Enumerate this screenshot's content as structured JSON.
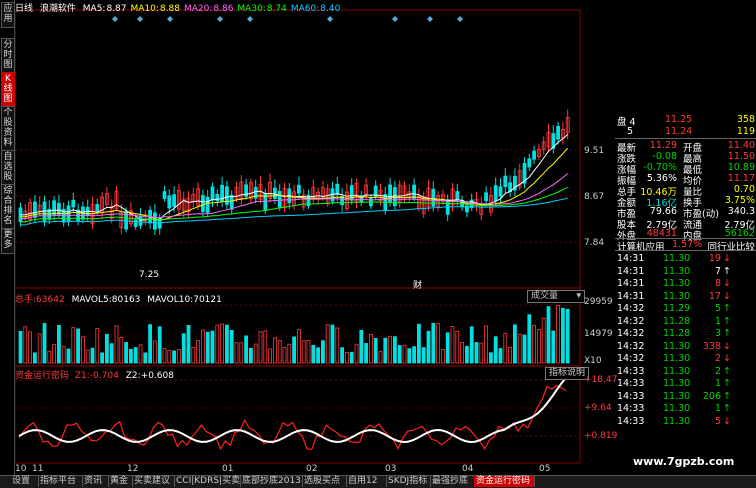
{
  "left_tabs": [
    "应用",
    "分时图",
    "K线图",
    "个股资料",
    "自选股",
    "综合排名",
    "更多"
  ],
  "header": {
    "period": "日线",
    "stock": "浪潮软件",
    "ma": [
      {
        "label": "MA5:",
        "value": "8.87",
        "color": "#ffffff"
      },
      {
        "label": "MA10:",
        "value": "8.88",
        "color": "#ffff00"
      },
      {
        "label": "MA20:",
        "value": "8.86",
        "color": "#ff66ff"
      },
      {
        "label": "MA30:",
        "value": "8.74",
        "color": "#00ff00"
      },
      {
        "label": "MA60:",
        "value": "8.40",
        "color": "#00ccff"
      }
    ]
  },
  "price_axis": [
    "9.51",
    "8.67",
    "7.84"
  ],
  "low_marker": "7.25",
  "cai_marker": "财",
  "volume_header": {
    "label": "总手:",
    "value": "63642",
    "ma5_label": "MAVOL5:",
    "ma5": "80163",
    "ma10_label": "MAVOL10:",
    "ma10": "70121",
    "btn": "成交量"
  },
  "volume_axis": [
    "29959",
    "14979",
    "X10"
  ],
  "indicator_header": {
    "name": "资金运行密码",
    "z1_label": "Z1:",
    "z1": "-0.704",
    "z2_label": "Z2:",
    "z2": "+0.608",
    "btn": "指标说明"
  },
  "indicator_axis": [
    "+18.47",
    "+9.64",
    "+0.819"
  ],
  "date_axis": [
    "10",
    "11",
    "12",
    "01",
    "02",
    "03",
    "04",
    "05"
  ],
  "quote": {
    "bid_rows": [
      {
        "label": "盘 4",
        "price": "11.25",
        "vol": "358"
      },
      {
        "label": "5",
        "price": "11.24",
        "vol": "119"
      }
    ],
    "stats": [
      {
        "l1": "最新",
        "v1": "11.29",
        "c1": "red",
        "l2": "开盘",
        "v2": "11.40",
        "c2": "red"
      },
      {
        "l1": "涨跌",
        "v1": "-0.08",
        "c1": "green",
        "l2": "最高",
        "v2": "11.50",
        "c2": "red"
      },
      {
        "l1": "涨幅",
        "v1": "-0.70%",
        "c1": "green",
        "l2": "最低",
        "v2": "10.89",
        "c2": "green"
      },
      {
        "l1": "振幅",
        "v1": "5.36%",
        "c1": "white",
        "l2": "均价",
        "v2": "11.17",
        "c2": "red"
      },
      {
        "l1": "总手",
        "v1": "10.46万",
        "c1": "yellow",
        "l2": "量比",
        "v2": "0.70",
        "c2": "yellow"
      },
      {
        "l1": "金额",
        "v1": "1.16亿",
        "c1": "cyan",
        "l2": "换手",
        "v2": "3.75%",
        "c2": "yellow"
      },
      {
        "l1": "市盈",
        "v1": "79.66",
        "c1": "white",
        "l2": "市盈(动)",
        "v2": "340.3",
        "c2": "white"
      },
      {
        "l1": "股本",
        "v1": "2.79亿",
        "c1": "white",
        "l2": "流通",
        "v2": "2.79亿",
        "c2": "white"
      },
      {
        "l1": "外盘",
        "v1": "48431",
        "c1": "red",
        "l2": "内盘",
        "v2": "56162",
        "c2": "green"
      }
    ],
    "industry": {
      "name": "计算机应用",
      "pct": "1.57%",
      "compare": "同行业比较"
    },
    "ticks": [
      {
        "t": "14:31",
        "p": "11.30",
        "v": "19",
        "arrow": "↓",
        "c": "red"
      },
      {
        "t": "14:31",
        "p": "11.30",
        "v": "7",
        "arrow": "↑",
        "c": "white"
      },
      {
        "t": "14:31",
        "p": "11.30",
        "v": "8",
        "arrow": "↓",
        "c": "red"
      },
      {
        "t": "14:31",
        "p": "11.30",
        "v": "17",
        "arrow": "↓",
        "c": "red"
      },
      {
        "t": "14:32",
        "p": "11.29",
        "v": "5",
        "arrow": "↑",
        "c": "green"
      },
      {
        "t": "14:32",
        "p": "11.28",
        "v": "1",
        "arrow": "↑",
        "c": "green"
      },
      {
        "t": "14:32",
        "p": "11.28",
        "v": "3",
        "arrow": "↑",
        "c": "green"
      },
      {
        "t": "14:32",
        "p": "11.30",
        "v": "338",
        "arrow": "↓",
        "c": "red"
      },
      {
        "t": "14:32",
        "p": "11.30",
        "v": "2",
        "arrow": "↓",
        "c": "red"
      },
      {
        "t": "14:33",
        "p": "11.30",
        "v": "2",
        "arrow": "↑",
        "c": "green"
      },
      {
        "t": "14:33",
        "p": "11.30",
        "v": "1",
        "arrow": "↑",
        "c": "green"
      },
      {
        "t": "14:33",
        "p": "11.30",
        "v": "206",
        "arrow": "↑",
        "c": "green"
      },
      {
        "t": "14:33",
        "p": "11.30",
        "v": "1",
        "arrow": "↑",
        "c": "green"
      },
      {
        "t": "14:33",
        "p": "11.30",
        "v": "5",
        "arrow": "↓",
        "c": "red"
      }
    ]
  },
  "bottom_tabs": [
    "设置",
    "指标平台",
    "资讯",
    "黄金",
    "买卖建议",
    "CCI|KDRS|买卖",
    "底部抄底2013",
    "选股买点",
    "自用12",
    "SKDJ指标",
    "最强抄底",
    "资金运行密码"
  ],
  "bottom_active": 11,
  "watermark": "www.7gpzb.com",
  "colors": {
    "up": "#ff3b3b",
    "down": "#00e0e0",
    "bg": "#000000"
  }
}
